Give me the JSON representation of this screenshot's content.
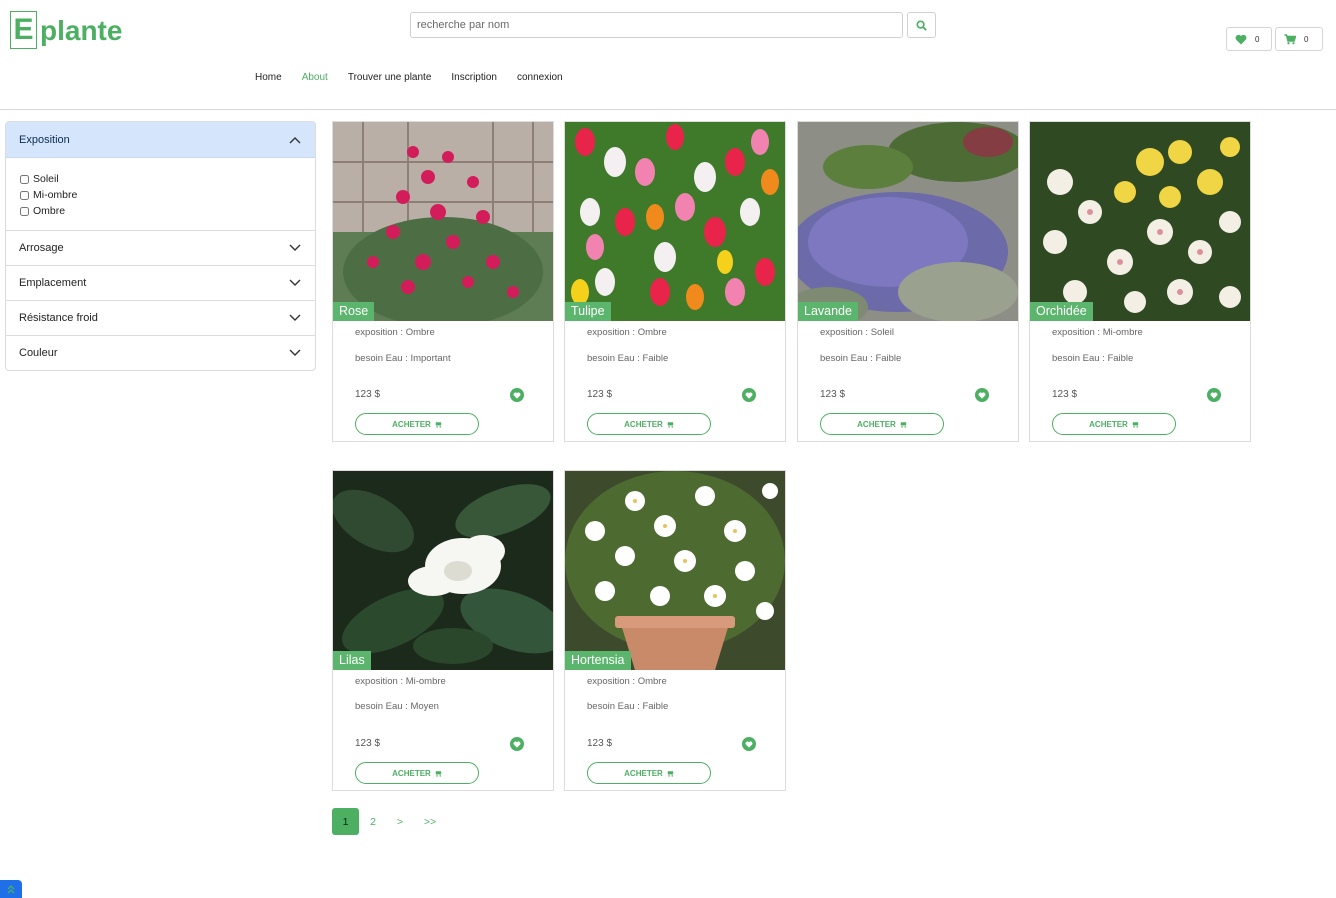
{
  "brand": {
    "letter": "E",
    "name": "plante"
  },
  "search": {
    "placeholder": "recherche par nom"
  },
  "header": {
    "wishlist_count": "0",
    "cart_count": "0"
  },
  "nav": [
    {
      "label": "Home",
      "active": false
    },
    {
      "label": "About",
      "active": true
    },
    {
      "label": "Trouver une plante",
      "active": false
    },
    {
      "label": "Inscription",
      "active": false
    },
    {
      "label": "connexion",
      "active": false
    }
  ],
  "filters": {
    "exposition": {
      "title": "Exposition",
      "options": [
        "Soleil",
        "Mi-ombre",
        "Ombre"
      ]
    },
    "arrosage": {
      "title": "Arrosage"
    },
    "emplacement": {
      "title": "Emplacement"
    },
    "resistance": {
      "title": "Résistance froid"
    },
    "couleur": {
      "title": "Couleur"
    }
  },
  "products": [
    {
      "name": "Rose",
      "exposition": "exposition : Ombre",
      "eau": "besoin Eau : Important",
      "price": "123 $",
      "buy": "ACHETER"
    },
    {
      "name": "Tulipe",
      "exposition": "exposition : Ombre",
      "eau": "besoin Eau : Faible",
      "price": "123 $",
      "buy": "ACHETER"
    },
    {
      "name": "Lavande",
      "exposition": "exposition : Soleil",
      "eau": "besoin Eau : Faible",
      "price": "123 $",
      "buy": "ACHETER"
    },
    {
      "name": "Orchidée",
      "exposition": "exposition : Mi-ombre",
      "eau": "besoin Eau : Faible",
      "price": "123 $",
      "buy": "ACHETER"
    },
    {
      "name": "Lilas",
      "exposition": "exposition : Mi-ombre",
      "eau": "besoin Eau : Moyen",
      "price": "123 $",
      "buy": "ACHETER"
    },
    {
      "name": "Hortensia",
      "exposition": "exposition : Ombre",
      "eau": "besoin Eau : Faible",
      "price": "123 $",
      "buy": "ACHETER"
    }
  ],
  "pagination": [
    "1",
    "2",
    ">",
    ">>"
  ],
  "colors": {
    "accent": "#4caf62",
    "filter_active_bg": "#d5e6fc",
    "scroll_top": "#1e6fe8"
  },
  "icons": [
    "search-icon",
    "heart-icon",
    "cart-icon",
    "chevron-up-icon",
    "chevron-down-icon",
    "double-chevron-up-icon"
  ]
}
